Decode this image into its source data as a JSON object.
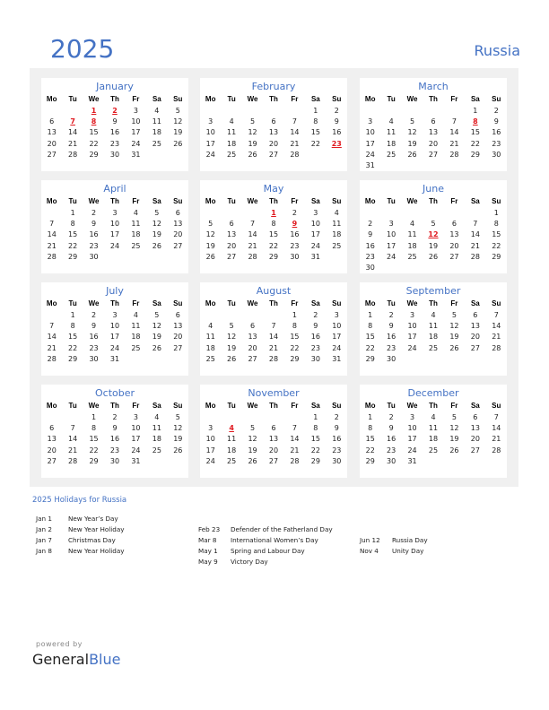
{
  "header": {
    "year": "2025",
    "country": "Russia"
  },
  "weekdays": [
    "Mo",
    "Tu",
    "We",
    "Th",
    "Fr",
    "Sa",
    "Su"
  ],
  "months": [
    {
      "name": "January",
      "offset": 2,
      "days": 31,
      "holidays": [
        1,
        2,
        7,
        8
      ]
    },
    {
      "name": "February",
      "offset": 5,
      "days": 28,
      "holidays": [
        23
      ]
    },
    {
      "name": "March",
      "offset": 5,
      "days": 31,
      "holidays": [
        8
      ]
    },
    {
      "name": "April",
      "offset": 1,
      "days": 30,
      "holidays": []
    },
    {
      "name": "May",
      "offset": 3,
      "days": 31,
      "holidays": [
        1,
        9
      ]
    },
    {
      "name": "June",
      "offset": 6,
      "days": 30,
      "holidays": [
        12
      ]
    },
    {
      "name": "July",
      "offset": 1,
      "days": 31,
      "holidays": []
    },
    {
      "name": "August",
      "offset": 4,
      "days": 31,
      "holidays": []
    },
    {
      "name": "September",
      "offset": 0,
      "days": 30,
      "holidays": []
    },
    {
      "name": "October",
      "offset": 2,
      "days": 31,
      "holidays": []
    },
    {
      "name": "November",
      "offset": 5,
      "days": 30,
      "holidays": [
        4
      ]
    },
    {
      "name": "December",
      "offset": 0,
      "days": 31,
      "holidays": []
    }
  ],
  "holidays_section": {
    "title": "2025 Holidays for Russia",
    "columns": [
      [
        {
          "date": "Jan 1",
          "name": "New Year’s Day"
        },
        {
          "date": "Jan 2",
          "name": "New Year Holiday"
        },
        {
          "date": "Jan 7",
          "name": "Christmas Day"
        },
        {
          "date": "Jan 8",
          "name": "New Year Holiday"
        }
      ],
      [
        {
          "date": "Feb 23",
          "name": "Defender of the Fatherland Day"
        },
        {
          "date": "Mar 8",
          "name": "International Women’s Day"
        },
        {
          "date": "May 1",
          "name": "Spring and Labour Day"
        },
        {
          "date": "May 9",
          "name": "Victory Day"
        }
      ],
      [
        {
          "date": "Jun 12",
          "name": "Russia Day"
        },
        {
          "date": "Nov 4",
          "name": "Unity Day"
        }
      ]
    ]
  },
  "footer": {
    "powered_by": "powered by",
    "brand_general": "General",
    "brand_blue": "Blue"
  },
  "colors": {
    "accent": "#4472c4",
    "holiday": "#e0191f",
    "panel": "#f0f0f0"
  }
}
